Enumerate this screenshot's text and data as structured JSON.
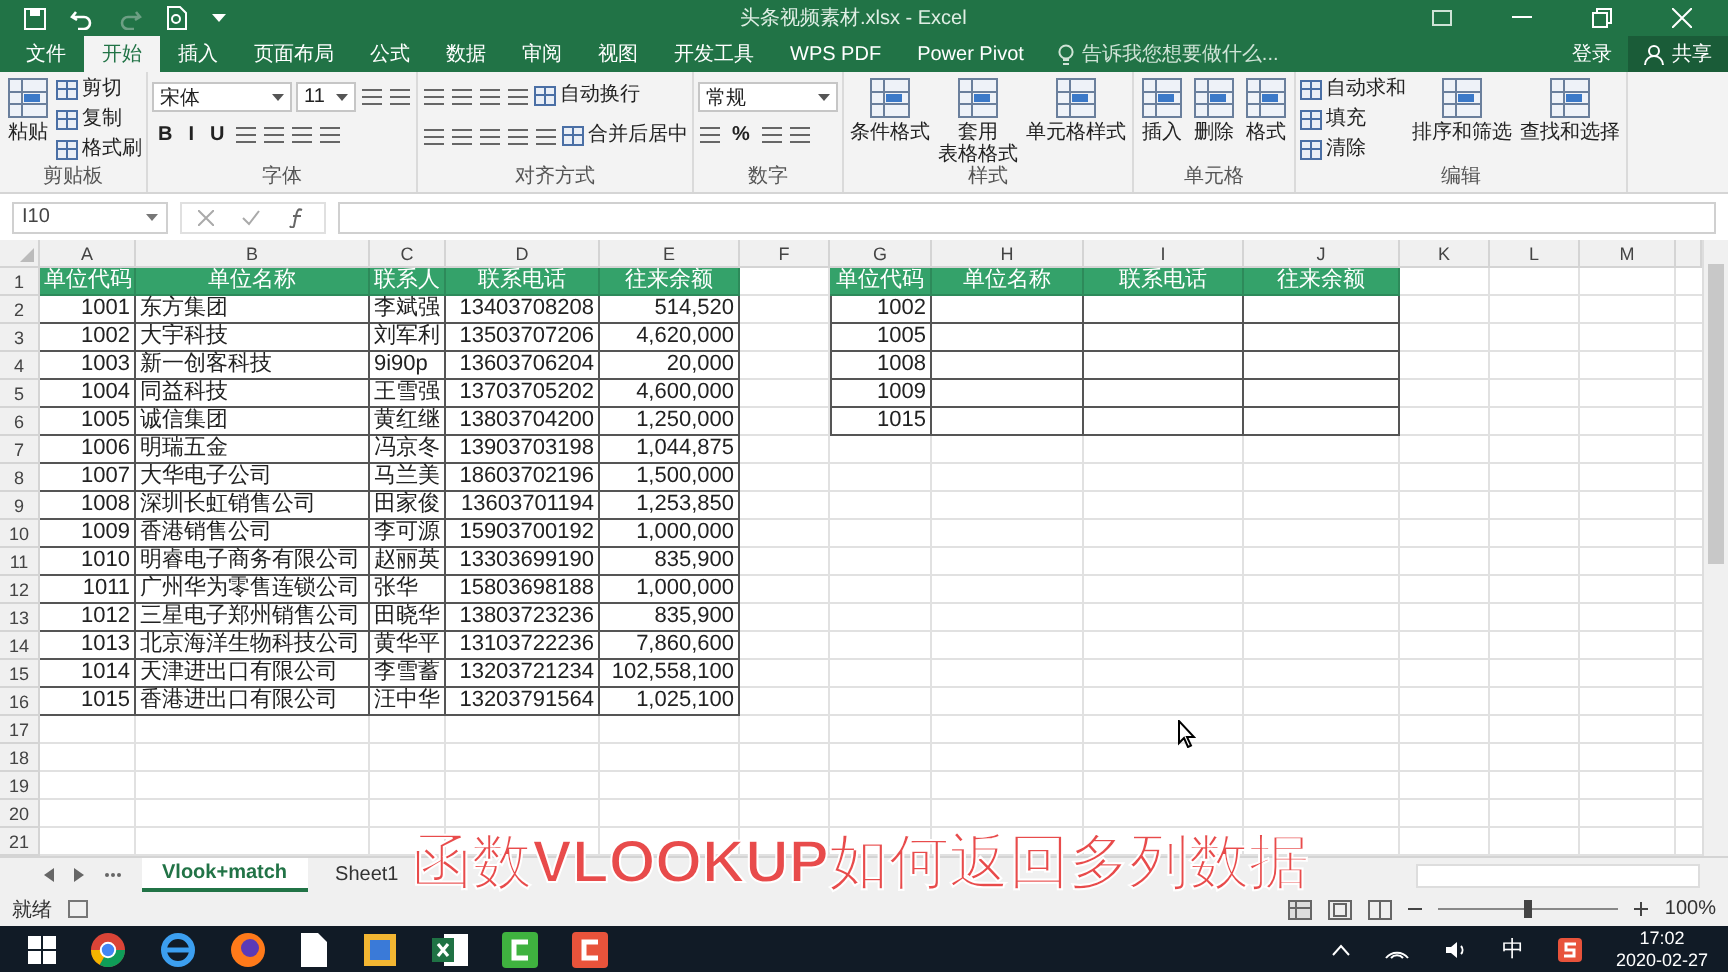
{
  "window": {
    "title": "头条视频素材.xlsx - Excel"
  },
  "menu_tabs": [
    {
      "label": "文件",
      "selected": false
    },
    {
      "label": "开始",
      "selected": true
    },
    {
      "label": "插入",
      "selected": false
    },
    {
      "label": "页面布局",
      "selected": false
    },
    {
      "label": "公式",
      "selected": false
    },
    {
      "label": "数据",
      "selected": false
    },
    {
      "label": "审阅",
      "selected": false
    },
    {
      "label": "视图",
      "selected": false
    },
    {
      "label": "开发工具",
      "selected": false
    },
    {
      "label": "WPS PDF",
      "selected": false
    },
    {
      "label": "Power Pivot",
      "selected": false
    }
  ],
  "tell_me": {
    "placeholder": "告诉我您想要做什么..."
  },
  "account": {
    "login": "登录",
    "share": "共享"
  },
  "ribbon_groups": [
    {
      "label": "剪贴板",
      "items": [
        {
          "kind": "large",
          "label": "粘贴"
        },
        {
          "kind": "small",
          "label": "剪切"
        },
        {
          "kind": "small",
          "label": "复制"
        },
        {
          "kind": "small",
          "label": "格式刷"
        }
      ]
    },
    {
      "label": "字体",
      "lines": [
        {
          "controls": [
            {
              "kind": "field",
              "value": "宋体"
            },
            {
              "kind": "combo",
              "value": "11"
            },
            {
              "kind": "icon"
            },
            {
              "kind": "icon"
            }
          ]
        },
        {
          "controls": [
            {
              "kind": "text",
              "label": "B"
            },
            {
              "kind": "text",
              "label": "I"
            },
            {
              "kind": "text",
              "label": "U"
            },
            {
              "kind": "icon"
            },
            {
              "kind": "icon"
            },
            {
              "kind": "icon"
            },
            {
              "kind": "icon"
            }
          ]
        }
      ]
    },
    {
      "label": "对齐方式",
      "lines": [
        {
          "controls": [
            {
              "kind": "icon"
            },
            {
              "kind": "icon"
            },
            {
              "kind": "icon"
            },
            {
              "kind": "icon"
            },
            {
              "kind": "small",
              "label": "自动换行"
            }
          ]
        },
        {
          "controls": [
            {
              "kind": "icon"
            },
            {
              "kind": "icon"
            },
            {
              "kind": "icon"
            },
            {
              "kind": "icon"
            },
            {
              "kind": "icon"
            },
            {
              "kind": "small",
              "label": "合并后居中"
            }
          ]
        }
      ]
    },
    {
      "label": "数字",
      "lines": [
        {
          "controls": [
            {
              "kind": "field",
              "value": "常规"
            }
          ]
        },
        {
          "controls": [
            {
              "kind": "icon"
            },
            {
              "kind": "text",
              "label": "%"
            },
            {
              "kind": "icon"
            },
            {
              "kind": "icon"
            }
          ]
        }
      ]
    },
    {
      "label": "样式",
      "items": [
        {
          "kind": "large",
          "label": "条件格式"
        },
        {
          "kind": "large",
          "text_lines": [
            "套用",
            "表格格式"
          ]
        },
        {
          "kind": "large",
          "label": "单元格样式"
        }
      ]
    },
    {
      "label": "单元格",
      "items": [
        {
          "kind": "large",
          "label": "插入"
        },
        {
          "kind": "large",
          "label": "删除"
        },
        {
          "kind": "large",
          "label": "格式"
        }
      ]
    },
    {
      "label": "编辑",
      "items": [
        {
          "kind": "small",
          "label": "自动求和"
        },
        {
          "kind": "small",
          "label": "填充"
        },
        {
          "kind": "small",
          "label": "清除"
        },
        {
          "kind": "large",
          "label": "排序和筛选"
        },
        {
          "kind": "large",
          "label": "查找和选择"
        }
      ]
    }
  ],
  "name_box": "I10",
  "column_letters": [
    "A",
    "B",
    "C",
    "D",
    "E",
    "F",
    "G",
    "H",
    "I",
    "J",
    "K",
    "L",
    "M"
  ],
  "row_numbers": [
    "1",
    "2",
    "3",
    "4",
    "5",
    "6",
    "7",
    "8",
    "9",
    "10",
    "11",
    "12",
    "13",
    "14",
    "15",
    "16",
    "17",
    "18",
    "19",
    "20",
    "21"
  ],
  "source_table": {
    "columns": [
      "单位代码",
      "单位名称",
      "联系人",
      "联系电话",
      "往来余额"
    ],
    "rows": [
      [
        "1001",
        "东方集团",
        "李斌强",
        "13403708208",
        "514,520"
      ],
      [
        "1002",
        "大宇科技",
        "刘军利",
        "13503707206",
        "4,620,000"
      ],
      [
        "1003",
        "新一创客科技",
        "9i90p",
        "13603706204",
        "20,000"
      ],
      [
        "1004",
        "同益科技",
        "王雪强",
        "13703705202",
        "4,600,000"
      ],
      [
        "1005",
        "诚信集团",
        "黄红继",
        "13803704200",
        "1,250,000"
      ],
      [
        "1006",
        "明瑞五金",
        "冯京冬",
        "13903703198",
        "1,044,875"
      ],
      [
        "1007",
        "大华电子公司",
        "马兰美",
        "18603702196",
        "1,500,000"
      ],
      [
        "1008",
        "深圳长虹销售公司",
        "田家俊",
        "13603701194",
        "1,253,850"
      ],
      [
        "1009",
        "香港销售公司",
        "李可源",
        "15903700192",
        "1,000,000"
      ],
      [
        "1010",
        "明睿电子商务有限公司",
        "赵丽英",
        "13303699190",
        "835,900"
      ],
      [
        "1011",
        "广州华为零售连锁公司",
        "张华",
        "15803698188",
        "1,000,000"
      ],
      [
        "1012",
        "三星电子郑州销售公司",
        "田晓华",
        "13803723236",
        "835,900"
      ],
      [
        "1013",
        "北京海洋生物科技公司",
        "黄华平",
        "13103722236",
        "7,860,600"
      ],
      [
        "1014",
        "天津进出口有限公司",
        "李雪蓄",
        "13203721234",
        "102,558,100"
      ],
      [
        "1015",
        "香港进出口有限公司",
        "汪中华",
        "13203791564",
        "1,025,100"
      ]
    ]
  },
  "lookup_table": {
    "columns": [
      "单位代码",
      "单位名称",
      "联系电话",
      "往来余额"
    ],
    "rows": [
      {
        "code": "1002"
      },
      {
        "code": "1005"
      },
      {
        "code": "1008"
      },
      {
        "code": "1009"
      },
      {
        "code": "1015"
      }
    ]
  },
  "sheet_tabs": [
    {
      "label": "Vlook+match",
      "selected": true
    },
    {
      "label": "Sheet1",
      "selected": false
    }
  ],
  "video_caption": "函数**VLOOKUP**如何返回多列数据",
  "status_bar": {
    "status": "就绪",
    "zoom": "100%",
    "zoom_slider": {
      "level": 0.5
    }
  },
  "taskbar": {
    "ime": "中",
    "time": "17:02",
    "date": "2020-02-27"
  }
}
